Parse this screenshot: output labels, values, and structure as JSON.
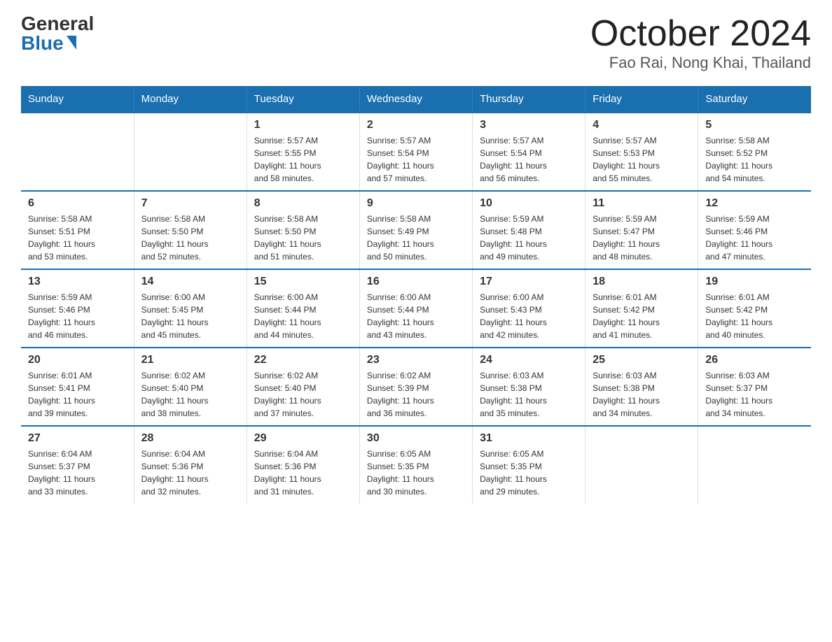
{
  "logo": {
    "general": "General",
    "blue": "Blue"
  },
  "title": "October 2024",
  "location": "Fao Rai, Nong Khai, Thailand",
  "days_of_week": [
    "Sunday",
    "Monday",
    "Tuesday",
    "Wednesday",
    "Thursday",
    "Friday",
    "Saturday"
  ],
  "weeks": [
    [
      {
        "day": "",
        "info": ""
      },
      {
        "day": "",
        "info": ""
      },
      {
        "day": "1",
        "info": "Sunrise: 5:57 AM\nSunset: 5:55 PM\nDaylight: 11 hours\nand 58 minutes."
      },
      {
        "day": "2",
        "info": "Sunrise: 5:57 AM\nSunset: 5:54 PM\nDaylight: 11 hours\nand 57 minutes."
      },
      {
        "day": "3",
        "info": "Sunrise: 5:57 AM\nSunset: 5:54 PM\nDaylight: 11 hours\nand 56 minutes."
      },
      {
        "day": "4",
        "info": "Sunrise: 5:57 AM\nSunset: 5:53 PM\nDaylight: 11 hours\nand 55 minutes."
      },
      {
        "day": "5",
        "info": "Sunrise: 5:58 AM\nSunset: 5:52 PM\nDaylight: 11 hours\nand 54 minutes."
      }
    ],
    [
      {
        "day": "6",
        "info": "Sunrise: 5:58 AM\nSunset: 5:51 PM\nDaylight: 11 hours\nand 53 minutes."
      },
      {
        "day": "7",
        "info": "Sunrise: 5:58 AM\nSunset: 5:50 PM\nDaylight: 11 hours\nand 52 minutes."
      },
      {
        "day": "8",
        "info": "Sunrise: 5:58 AM\nSunset: 5:50 PM\nDaylight: 11 hours\nand 51 minutes."
      },
      {
        "day": "9",
        "info": "Sunrise: 5:58 AM\nSunset: 5:49 PM\nDaylight: 11 hours\nand 50 minutes."
      },
      {
        "day": "10",
        "info": "Sunrise: 5:59 AM\nSunset: 5:48 PM\nDaylight: 11 hours\nand 49 minutes."
      },
      {
        "day": "11",
        "info": "Sunrise: 5:59 AM\nSunset: 5:47 PM\nDaylight: 11 hours\nand 48 minutes."
      },
      {
        "day": "12",
        "info": "Sunrise: 5:59 AM\nSunset: 5:46 PM\nDaylight: 11 hours\nand 47 minutes."
      }
    ],
    [
      {
        "day": "13",
        "info": "Sunrise: 5:59 AM\nSunset: 5:46 PM\nDaylight: 11 hours\nand 46 minutes."
      },
      {
        "day": "14",
        "info": "Sunrise: 6:00 AM\nSunset: 5:45 PM\nDaylight: 11 hours\nand 45 minutes."
      },
      {
        "day": "15",
        "info": "Sunrise: 6:00 AM\nSunset: 5:44 PM\nDaylight: 11 hours\nand 44 minutes."
      },
      {
        "day": "16",
        "info": "Sunrise: 6:00 AM\nSunset: 5:44 PM\nDaylight: 11 hours\nand 43 minutes."
      },
      {
        "day": "17",
        "info": "Sunrise: 6:00 AM\nSunset: 5:43 PM\nDaylight: 11 hours\nand 42 minutes."
      },
      {
        "day": "18",
        "info": "Sunrise: 6:01 AM\nSunset: 5:42 PM\nDaylight: 11 hours\nand 41 minutes."
      },
      {
        "day": "19",
        "info": "Sunrise: 6:01 AM\nSunset: 5:42 PM\nDaylight: 11 hours\nand 40 minutes."
      }
    ],
    [
      {
        "day": "20",
        "info": "Sunrise: 6:01 AM\nSunset: 5:41 PM\nDaylight: 11 hours\nand 39 minutes."
      },
      {
        "day": "21",
        "info": "Sunrise: 6:02 AM\nSunset: 5:40 PM\nDaylight: 11 hours\nand 38 minutes."
      },
      {
        "day": "22",
        "info": "Sunrise: 6:02 AM\nSunset: 5:40 PM\nDaylight: 11 hours\nand 37 minutes."
      },
      {
        "day": "23",
        "info": "Sunrise: 6:02 AM\nSunset: 5:39 PM\nDaylight: 11 hours\nand 36 minutes."
      },
      {
        "day": "24",
        "info": "Sunrise: 6:03 AM\nSunset: 5:38 PM\nDaylight: 11 hours\nand 35 minutes."
      },
      {
        "day": "25",
        "info": "Sunrise: 6:03 AM\nSunset: 5:38 PM\nDaylight: 11 hours\nand 34 minutes."
      },
      {
        "day": "26",
        "info": "Sunrise: 6:03 AM\nSunset: 5:37 PM\nDaylight: 11 hours\nand 34 minutes."
      }
    ],
    [
      {
        "day": "27",
        "info": "Sunrise: 6:04 AM\nSunset: 5:37 PM\nDaylight: 11 hours\nand 33 minutes."
      },
      {
        "day": "28",
        "info": "Sunrise: 6:04 AM\nSunset: 5:36 PM\nDaylight: 11 hours\nand 32 minutes."
      },
      {
        "day": "29",
        "info": "Sunrise: 6:04 AM\nSunset: 5:36 PM\nDaylight: 11 hours\nand 31 minutes."
      },
      {
        "day": "30",
        "info": "Sunrise: 6:05 AM\nSunset: 5:35 PM\nDaylight: 11 hours\nand 30 minutes."
      },
      {
        "day": "31",
        "info": "Sunrise: 6:05 AM\nSunset: 5:35 PM\nDaylight: 11 hours\nand 29 minutes."
      },
      {
        "day": "",
        "info": ""
      },
      {
        "day": "",
        "info": ""
      }
    ]
  ]
}
